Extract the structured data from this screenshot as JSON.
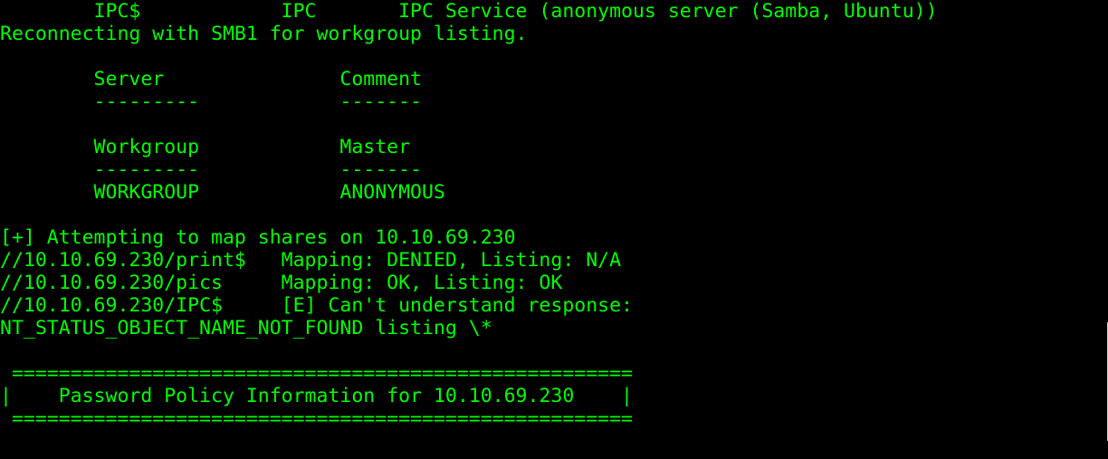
{
  "terminal": {
    "text_color": "#00ff00",
    "background_color": "#000000",
    "lines": [
      "        IPC$            IPC       IPC Service (anonymous server (Samba, Ubuntu))",
      "Reconnecting with SMB1 for workgroup listing.",
      "",
      "        Server               Comment",
      "        ---------            -------",
      "",
      "        Workgroup            Master",
      "        ---------            -------",
      "        WORKGROUP            ANONYMOUS",
      "",
      "[+] Attempting to map shares on 10.10.69.230",
      "//10.10.69.230/print$   Mapping: DENIED, Listing: N/A",
      "//10.10.69.230/pics     Mapping: OK, Listing: OK",
      "//10.10.69.230/IPC$     [E] Can't understand response:",
      "NT_STATUS_OBJECT_NAME_NOT_FOUND listing \\*",
      "",
      " =====================================================",
      "|    Password Policy Information for 10.10.69.230    |",
      " =====================================================",
      ""
    ]
  }
}
